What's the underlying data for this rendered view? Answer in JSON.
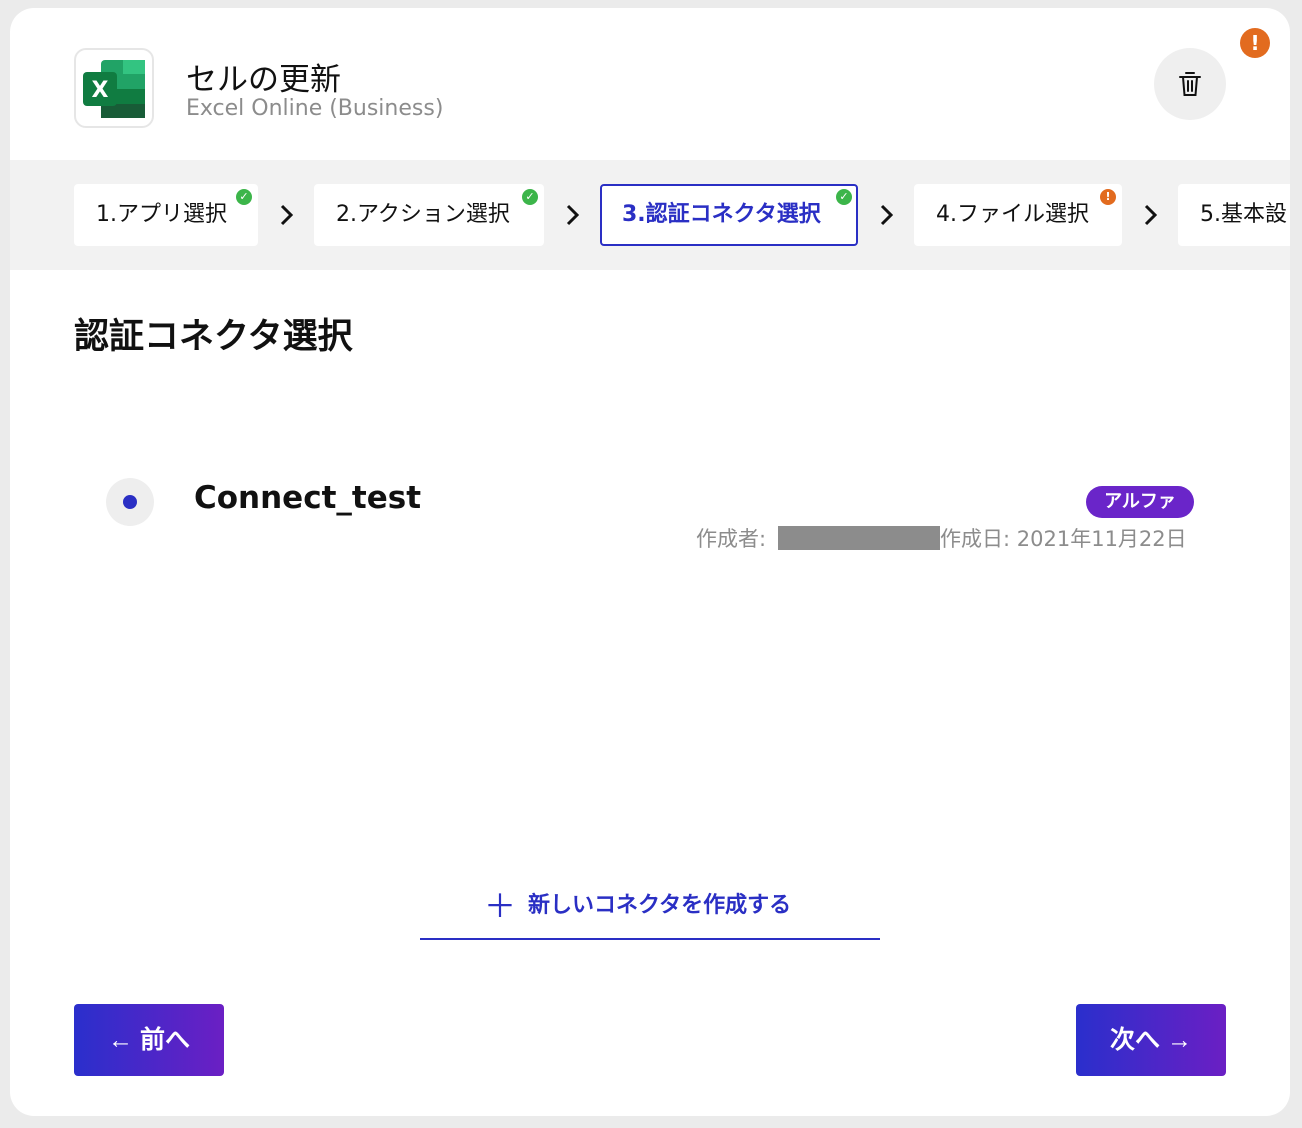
{
  "header": {
    "title": "セルの更新",
    "subtitle": "Excel Online (Business)",
    "app_icon": "excel-icon",
    "delete_icon": "trash-icon",
    "alert_mark": "!"
  },
  "steps": [
    {
      "label": "1.アプリ選択",
      "status": "complete",
      "mark": "✓"
    },
    {
      "label": "2.アクション選択",
      "status": "complete",
      "mark": "✓"
    },
    {
      "label": "3.認証コネクタ選択",
      "status": "active",
      "mark": "✓"
    },
    {
      "label": "4.ファイル選択",
      "status": "warning",
      "mark": "!"
    },
    {
      "label": "5.基本設",
      "status": "pending"
    }
  ],
  "section": {
    "title": "認証コネクタ選択"
  },
  "connector": {
    "name": "Connect_test",
    "tag": "アルファ",
    "created_by_label": "作成者:",
    "created_on_label": "作成日:",
    "created_on_value": "2021年11月22日",
    "selected": true
  },
  "create_new": {
    "plus": "＋",
    "label": "新しいコネクタを作成する"
  },
  "nav": {
    "prev_label": "← 前へ",
    "next_label": "次へ →"
  },
  "colors": {
    "accent": "#2a2fc4",
    "success": "#3cb54a",
    "warning": "#e26b1f",
    "tag": "#6a25c9"
  }
}
